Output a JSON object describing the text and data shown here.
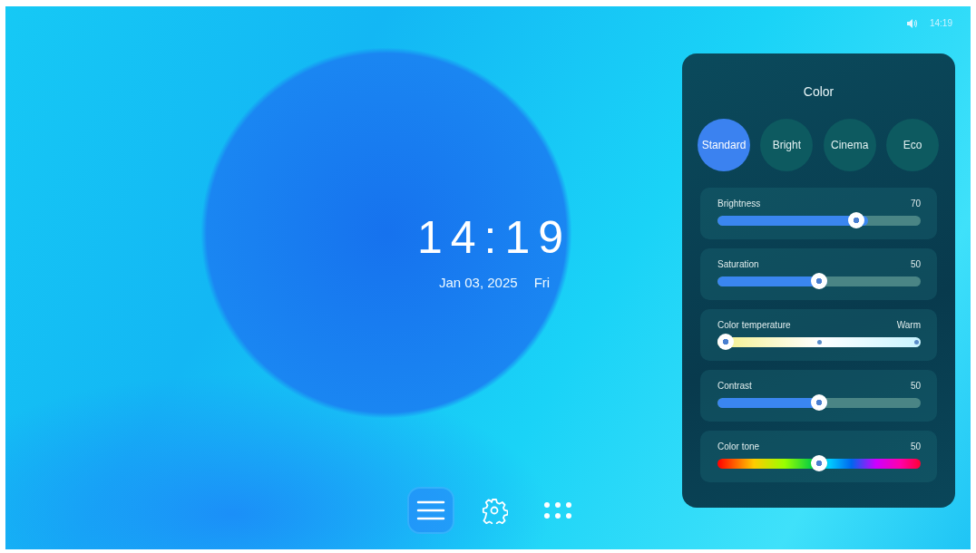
{
  "status_bar": {
    "time": "14:19"
  },
  "clock": {
    "time": "14:19",
    "date": "Jan 03, 2025",
    "weekday": "Fri"
  },
  "dock": [
    {
      "kind": "menu",
      "selected": true
    },
    {
      "kind": "settings",
      "selected": false
    },
    {
      "kind": "apps",
      "selected": false
    }
  ],
  "panel": {
    "title": "Color",
    "modes": [
      {
        "label": "Standard",
        "selected": true
      },
      {
        "label": "Bright",
        "selected": false
      },
      {
        "label": "Cinema",
        "selected": false
      },
      {
        "label": "Eco",
        "selected": false
      }
    ],
    "sliders": [
      {
        "kind": "fill",
        "label": "Brightness",
        "reading": "70",
        "level": 0.7
      },
      {
        "kind": "fill",
        "label": "Saturation",
        "reading": "50",
        "level": 0.5
      },
      {
        "kind": "temperature",
        "label": "Color temperature",
        "reading": "Warm",
        "level": 0
      },
      {
        "kind": "fill",
        "label": "Contrast",
        "reading": "50",
        "level": 0.5
      },
      {
        "kind": "hue",
        "label": "Color tone",
        "reading": "50",
        "level": 0.5
      }
    ]
  }
}
